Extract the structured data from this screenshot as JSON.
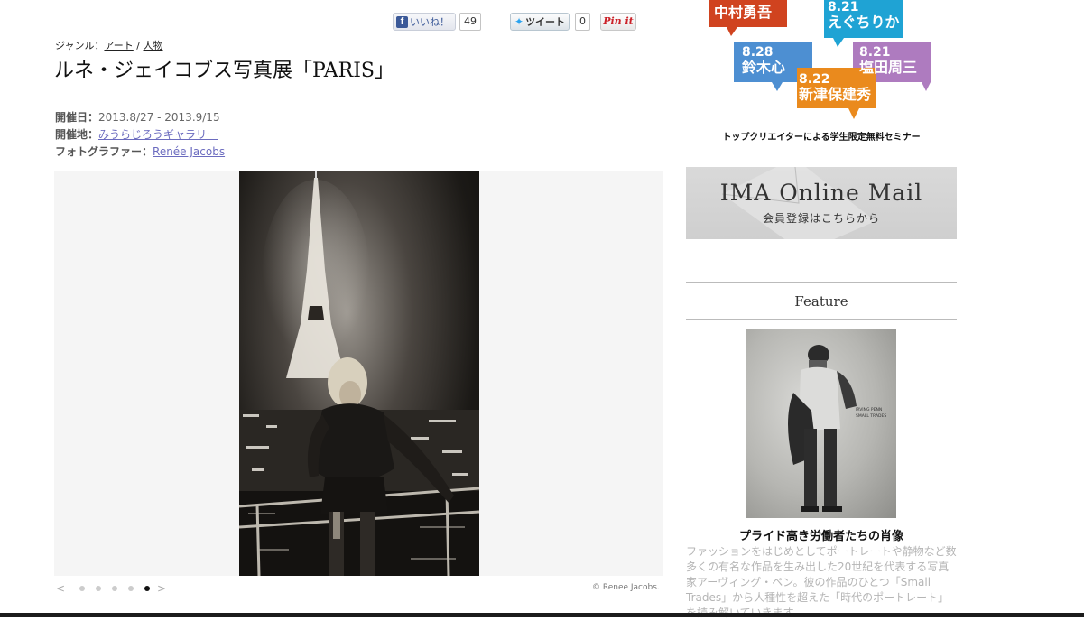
{
  "social": {
    "like_label": "いいね！",
    "like_count": "49",
    "tweet_label": "ツイート",
    "tweet_count": "0",
    "pin_label": "Pin it"
  },
  "article": {
    "genre_label": "ジャンル：",
    "genres": [
      "アート",
      "人物"
    ],
    "genre_sep": "/",
    "title": "ルネ・ジェイコブス写真展「PARIS」",
    "dates_label": "開催日：",
    "dates_value": "2013.8/27 - 2013.9/15",
    "venue_label": "開催地：",
    "venue_value": "みうらじろうギャラリー",
    "photographer_label": "フォトグラファー：",
    "photographer_value": "Renée Jacobs"
  },
  "carousel": {
    "prev": "<",
    "next": ">",
    "total_dots": 5,
    "active_index": 4,
    "credit": "© Renee Jacobs."
  },
  "sidebar": {
    "seminar_bubbles": [
      {
        "date": "",
        "name": "中村勇吾",
        "color": "#d0431f"
      },
      {
        "date": "8.21",
        "name": "えぐちりか",
        "color": "#1f9fd0"
      },
      {
        "date": "8.28",
        "name": "鈴木心",
        "color": "#4a8fd0"
      },
      {
        "date": "8.21",
        "name": "塩田周三",
        "color": "#a978b8"
      },
      {
        "date": "8.22",
        "name": "新津保建秀",
        "color": "#e8891e"
      }
    ],
    "seminar_caption": "トップクリエイターによる学生限定無料セミナー",
    "ima_mail_title": "IMA Online Mail",
    "ima_mail_sub": "会員登録はこちらから",
    "feature_heading": "Feature",
    "feature_cover_text_1": "IRVING PENN",
    "feature_cover_text_2": "SMALL TRADES",
    "feature_title": "プライド高き労働者たちの肖像",
    "feature_desc": "ファッションをはじめとしてポートレートや静物など数多くの有名な作品を生み出した20世紀を代表する写真家アーヴィング・ペン。彼の作品のひとつ「Small Trades」から人種性を超えた「時代のポートレート」を読み解いていきます。"
  }
}
